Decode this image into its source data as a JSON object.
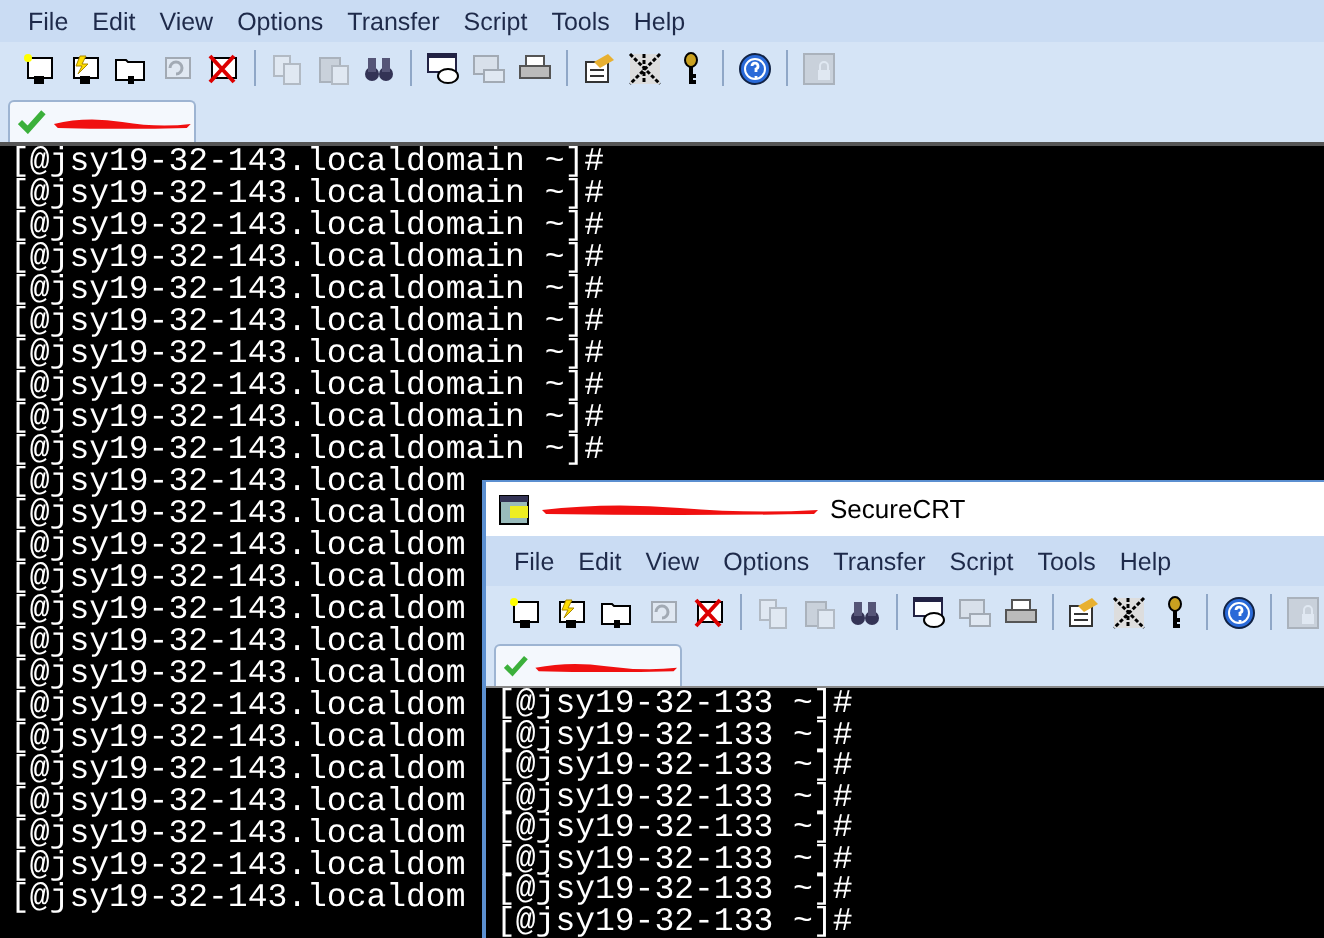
{
  "windows": [
    {
      "menu": [
        "File",
        "Edit",
        "View",
        "Options",
        "Transfer",
        "Script",
        "Tools",
        "Help"
      ],
      "toolbar": [
        {
          "kind": "new",
          "disabled": false
        },
        {
          "kind": "bolt",
          "disabled": false
        },
        {
          "kind": "folder",
          "disabled": false
        },
        {
          "kind": "reconnect",
          "disabled": true
        },
        {
          "kind": "disconnect",
          "disabled": false
        },
        {
          "kind": "sep"
        },
        {
          "kind": "copy",
          "disabled": true
        },
        {
          "kind": "paste",
          "disabled": true
        },
        {
          "kind": "find",
          "disabled": false
        },
        {
          "kind": "sep"
        },
        {
          "kind": "print-setup",
          "disabled": false
        },
        {
          "kind": "print-screen",
          "disabled": true
        },
        {
          "kind": "print",
          "disabled": false
        },
        {
          "kind": "sep"
        },
        {
          "kind": "options",
          "disabled": false
        },
        {
          "kind": "keymap",
          "disabled": false
        },
        {
          "kind": "key",
          "disabled": false
        },
        {
          "kind": "sep"
        },
        {
          "kind": "help",
          "disabled": false
        },
        {
          "kind": "sep"
        },
        {
          "kind": "lock",
          "disabled": true
        }
      ],
      "tabs": [
        {
          "selected": true,
          "connected": true
        }
      ],
      "lines": [
        "[@jsy19-32-143.localdomain ~]#",
        "[@jsy19-32-143.localdomain ~]#",
        "[@jsy19-32-143.localdomain ~]#",
        "[@jsy19-32-143.localdomain ~]#",
        "[@jsy19-32-143.localdomain ~]#",
        "[@jsy19-32-143.localdomain ~]#",
        "[@jsy19-32-143.localdomain ~]#",
        "[@jsy19-32-143.localdomain ~]#",
        "[@jsy19-32-143.localdomain ~]#",
        "[@jsy19-32-143.localdomain ~]#",
        "[@jsy19-32-143.localdom",
        "[@jsy19-32-143.localdom",
        "[@jsy19-32-143.localdom",
        "[@jsy19-32-143.localdom",
        "[@jsy19-32-143.localdom",
        "[@jsy19-32-143.localdom",
        "[@jsy19-32-143.localdom",
        "[@jsy19-32-143.localdom",
        "[@jsy19-32-143.localdom",
        "[@jsy19-32-143.localdom",
        "[@jsy19-32-143.localdom",
        "[@jsy19-32-143.localdom",
        "[@jsy19-32-143.localdom",
        "[@jsy19-32-143.localdom"
      ]
    },
    {
      "title": "SecureCRT",
      "menu": [
        "File",
        "Edit",
        "View",
        "Options",
        "Transfer",
        "Script",
        "Tools",
        "Help"
      ],
      "toolbar": [
        {
          "kind": "new",
          "disabled": false
        },
        {
          "kind": "bolt",
          "disabled": false
        },
        {
          "kind": "folder",
          "disabled": false
        },
        {
          "kind": "reconnect",
          "disabled": true
        },
        {
          "kind": "disconnect",
          "disabled": false
        },
        {
          "kind": "sep"
        },
        {
          "kind": "copy",
          "disabled": true
        },
        {
          "kind": "paste",
          "disabled": true
        },
        {
          "kind": "find",
          "disabled": false
        },
        {
          "kind": "sep"
        },
        {
          "kind": "print-setup",
          "disabled": false
        },
        {
          "kind": "print-screen",
          "disabled": true
        },
        {
          "kind": "print",
          "disabled": false
        },
        {
          "kind": "sep"
        },
        {
          "kind": "options",
          "disabled": false
        },
        {
          "kind": "keymap",
          "disabled": false
        },
        {
          "kind": "key",
          "disabled": false
        },
        {
          "kind": "sep"
        },
        {
          "kind": "help",
          "disabled": false
        },
        {
          "kind": "sep"
        },
        {
          "kind": "lock",
          "disabled": true
        }
      ],
      "tabs": [
        {
          "selected": true,
          "connected": true
        }
      ],
      "lines": [
        "[@jsy19-32-133 ~]#",
        "[@jsy19-32-133 ~]#",
        "[@jsy19-32-133 ~]#",
        "[@jsy19-32-133 ~]#",
        "[@jsy19-32-133 ~]#",
        "[@jsy19-32-133 ~]#",
        "[@jsy19-32-133 ~]#",
        "[@jsy19-32-133 ~]#"
      ]
    }
  ]
}
